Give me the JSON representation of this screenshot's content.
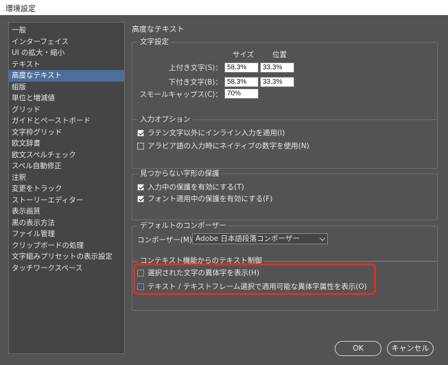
{
  "window": {
    "title": "環境設定"
  },
  "sidebar": {
    "items": [
      "一般",
      "インターフェイス",
      "UI の拡大・縮小",
      "テキスト",
      "高度なテキスト",
      "組版",
      "単位と増減値",
      "グリッド",
      "ガイドとペーストボード",
      "文字枠グリッド",
      "欧文辞書",
      "欧文スペルチェック",
      "スペル自動修正",
      "注釈",
      "変更をトラック",
      "ストーリーエディター",
      "表示画質",
      "黒の表示方法",
      "ファイル管理",
      "クリップボードの処理",
      "文字組みプリセットの表示設定",
      "タッチワークスペース"
    ],
    "selected_index": 4
  },
  "panel": {
    "title": "高度なテキスト",
    "char_settings": {
      "legend": "文字設定",
      "col_size": "サイズ",
      "col_position": "位置",
      "superscript": {
        "label": "上付き文字(S)：",
        "size": "58.3%",
        "position": "33.3%"
      },
      "subscript": {
        "label": "下付き文字(B)：",
        "size": "58.3%",
        "position": "33.3%"
      },
      "small_caps": {
        "label": "スモールキャップス(C)：",
        "size": "70%"
      }
    },
    "input_options": {
      "legend": "入力オプション",
      "opt1": {
        "label": "ラテン文字以外にインライン入力を適用(I)",
        "checked": true
      },
      "opt2": {
        "label": "アラビア語の入力時にネイティブの数字を使用(N)",
        "checked": false
      }
    },
    "missing_glyph": {
      "legend": "見つからない字形の保護",
      "opt1": {
        "label": "入力中の保護を有効にする(T)",
        "checked": true
      },
      "opt2": {
        "label": "フォント適用中の保護を有効にする(F)",
        "checked": true
      }
    },
    "composer": {
      "legend": "デフォルトのコンポーザー",
      "label": "コンポーザー(M)：",
      "value": "Adobe 日本語段落コンポーザー"
    },
    "context": {
      "legend": "コンテキスト機能からのテキスト制御",
      "opt1": {
        "label": "選択された文字の異体字を表示(H)",
        "checked": false
      },
      "opt2": {
        "label": "テキスト / テキストフレーム選択で適用可能な異体字属性を表示(O)",
        "checked": false
      }
    }
  },
  "buttons": {
    "ok": "OK",
    "cancel": "キャンセル"
  },
  "colors": {
    "highlight": "#d9302c",
    "selection": "#4d6e9c",
    "background": "#535353"
  }
}
